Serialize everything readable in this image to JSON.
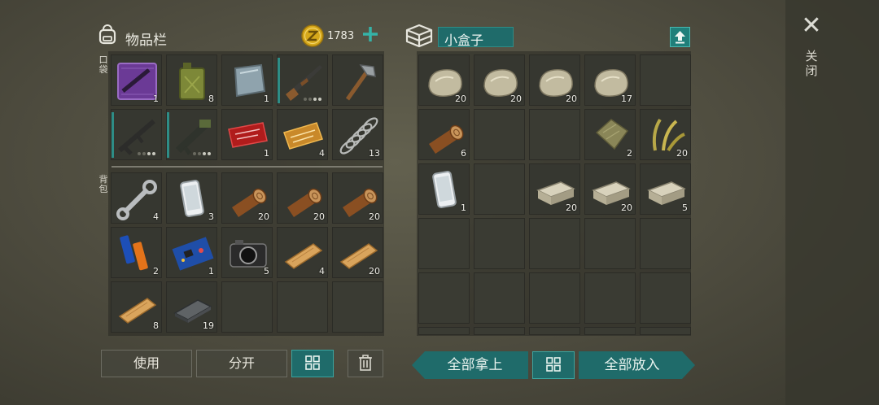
{
  "colors": {
    "accent": "#1f6b6a",
    "accent_light": "#3aa5a0",
    "coin": "#d6a81a"
  },
  "inventory": {
    "title": "物品栏",
    "currency": "1783",
    "pockets_label": "口袋",
    "backpack_label": "背包",
    "pockets": [
      {
        "icon": "purple-blueprint-icon",
        "count": "1"
      },
      {
        "icon": "jerrycan-icon",
        "count": "8"
      },
      {
        "icon": "metal-plate-icon",
        "count": "1"
      },
      {
        "icon": "shotgun-icon",
        "count": ""
      },
      {
        "icon": "hatchet-icon",
        "count": ""
      },
      {
        "icon": "assault-rifle-icon",
        "count": ""
      },
      {
        "icon": "grenade-launcher-icon",
        "count": ""
      },
      {
        "icon": "red-combat-coupon-icon",
        "count": "1"
      },
      {
        "icon": "orange-coupon-icon",
        "count": "4"
      },
      {
        "icon": "spring-icon",
        "count": "13"
      }
    ],
    "backpack": [
      {
        "icon": "wrench-icon",
        "count": "4"
      },
      {
        "icon": "smartphone-icon",
        "count": "3"
      },
      {
        "icon": "wood-log-icon",
        "count": "20"
      },
      {
        "icon": "wood-log-icon",
        "count": "20"
      },
      {
        "icon": "wood-log-icon",
        "count": "20"
      },
      {
        "icon": "batteries-icon",
        "count": "2"
      },
      {
        "icon": "circuit-board-icon",
        "count": "1"
      },
      {
        "icon": "camera-icon",
        "count": "5"
      },
      {
        "icon": "wood-plank-icon",
        "count": "4"
      },
      {
        "icon": "wood-plank-icon",
        "count": "20"
      },
      {
        "icon": "wood-plank-icon",
        "count": "8"
      },
      {
        "icon": "metal-bar-icon",
        "count": "19"
      },
      {
        "icon": "",
        "count": ""
      },
      {
        "icon": "",
        "count": ""
      },
      {
        "icon": "",
        "count": ""
      }
    ],
    "use_label": "使用",
    "split_label": "分开"
  },
  "container": {
    "title": "小盒子",
    "slots": [
      {
        "icon": "stone-icon",
        "count": "20"
      },
      {
        "icon": "stone-icon",
        "count": "20"
      },
      {
        "icon": "stone-icon",
        "count": "20"
      },
      {
        "icon": "stone-icon",
        "count": "17"
      },
      {
        "icon": "",
        "count": ""
      },
      {
        "icon": "wood-log-icon",
        "count": "6"
      },
      {
        "icon": "",
        "count": ""
      },
      {
        "icon": "",
        "count": ""
      },
      {
        "icon": "cloth-icon",
        "count": "2"
      },
      {
        "icon": "plant-fiber-icon",
        "count": "20"
      },
      {
        "icon": "smartphone-icon",
        "count": "1"
      },
      {
        "icon": "",
        "count": ""
      },
      {
        "icon": "stone-brick-icon",
        "count": "20"
      },
      {
        "icon": "stone-brick-icon",
        "count": "20"
      },
      {
        "icon": "stone-brick-icon",
        "count": "5"
      }
    ],
    "take_all_label": "全部拿上",
    "put_all_label": "全部放入"
  },
  "close_label": "关闭"
}
